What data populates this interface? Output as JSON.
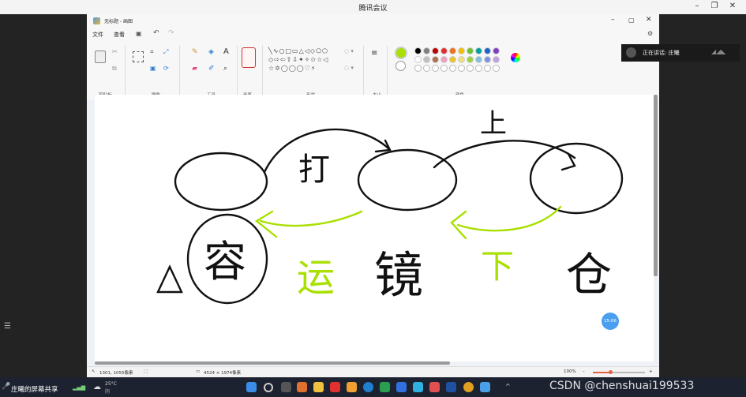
{
  "meeting": {
    "title": "腾讯会议"
  },
  "paint": {
    "title": "无标题 - 画图",
    "menu": [
      "文件",
      "查看"
    ],
    "groups": [
      "剪贴板",
      "图像",
      "工具",
      "画笔",
      "形状",
      "大小",
      "颜色"
    ],
    "status": {
      "cursor": "1301, 1055像素",
      "size": "4524 × 1974像素",
      "zoom": "100%"
    }
  },
  "colors": {
    "primary": "#a8e000",
    "palette_row1": [
      "#000000",
      "#808080",
      "#c00000",
      "#e03030",
      "#f07020",
      "#f5c000",
      "#70c030",
      "#00a0a0",
      "#2060d0",
      "#8040c0"
    ],
    "palette_row2": [
      "#ffffff",
      "#c0c0c0",
      "#b07050",
      "#f0a0c0",
      "#f0c030",
      "#f0e080",
      "#a0d040",
      "#80c0e0",
      "#8090e0",
      "#c0a0e0"
    ]
  },
  "drawing": {
    "chars": [
      "打",
      "上",
      "容",
      "运",
      "镜",
      "下",
      "仓"
    ]
  },
  "overlay": {
    "speaker": "正在讲话: 庄曦",
    "timer": "15:06",
    "share_label": "庄曦的屏幕共享",
    "watermark": "CSDN @chenshuai199533",
    "weather": "25°C",
    "weather_sub": "阴"
  }
}
